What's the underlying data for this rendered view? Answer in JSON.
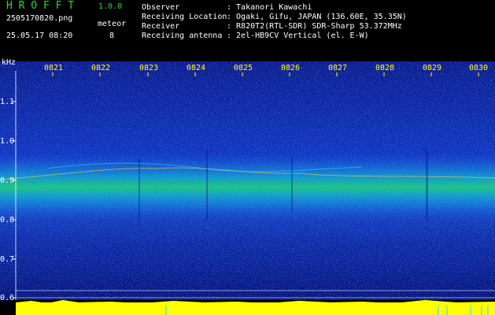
{
  "app": {
    "title": "H R O F F T",
    "version": "1.0.0"
  },
  "capture": {
    "file": "2505170820.png",
    "datetime": "25.05.17 08:20",
    "mode": "meteor",
    "count": "8"
  },
  "info": [
    {
      "key": "Observer",
      "value": ": Takanori Kawachi"
    },
    {
      "key": "Receiving Location",
      "value": ": Ogaki, Gifu, JAPAN (136.60E, 35.35N)"
    },
    {
      "key": "Receiver",
      "value": ": R820T2(RTL-SDR) SDR-Sharp 53.372MHz"
    },
    {
      "key": "Receiving antenna",
      "value": ": 2el-HB9CV Vertical (el. E-W)"
    }
  ],
  "axis": {
    "unit": "kHz",
    "freq_ticks": [
      "1.1",
      "1.0",
      "0.9",
      "0.8",
      "0.7",
      "0.6"
    ],
    "time_ticks": [
      "0821",
      "0822",
      "0823",
      "0824",
      "0825",
      "0826",
      "0827",
      "0828",
      "0829",
      "0830"
    ]
  },
  "colors": {
    "accent_green": "#2bd62b",
    "time_yellow": "#ffff00",
    "bar_yellow": "#ffff00"
  }
}
